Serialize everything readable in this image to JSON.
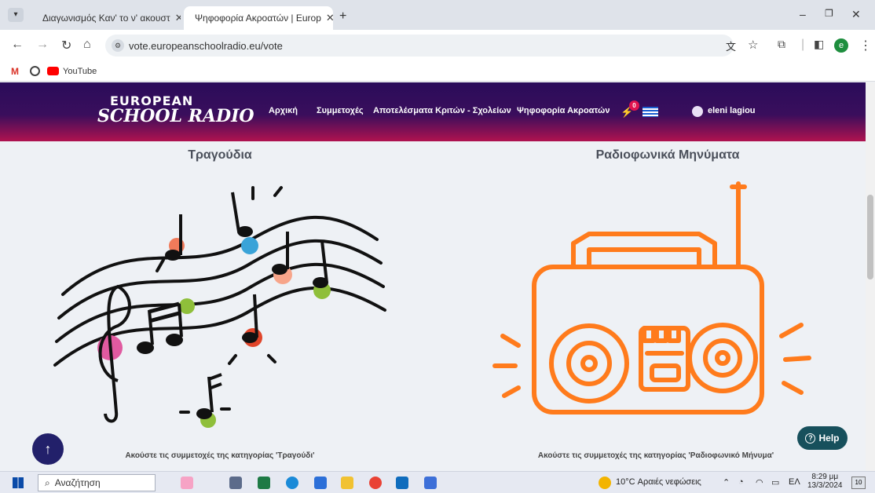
{
  "browser": {
    "tabs": [
      {
        "title": "Διαγωνισμός Καν' το ν' ακουστ"
      },
      {
        "title": "Ψηφοφορία Ακροατών | Europ"
      }
    ],
    "url": "vote.europeanschoolradio.eu/vote",
    "bookmarks": [
      {
        "label": "YouTube"
      }
    ],
    "profile_initial": "e"
  },
  "site": {
    "logo_top": "EUROPEAN",
    "logo_bottom": "SCHOOL RADIO",
    "nav": {
      "home": "Αρχική",
      "entries": "Συμμετοχές",
      "results": "Αποτελέσματα Κριτών - Σχολείων",
      "vote": "Ψηφοφορία Ακροατών",
      "badge_count": "0"
    },
    "user_name": "eleni lagiou"
  },
  "sections": [
    {
      "title": "Τραγούδια",
      "caption": "Ακούστε τις συμμετοχές της κατηγορίας 'Τραγούδι'"
    },
    {
      "title": "Ραδιοφωνικά Μηνύματα",
      "caption": "Ακούστε τις συμμετοχές της κατηγορίας 'Ραδιοφωνικό Μήνυμα'"
    }
  ],
  "help_label": "Help",
  "up_icon": "↑",
  "taskbar": {
    "search_placeholder": "Αναζήτηση",
    "weather": "10°C  Αραιές νεφώσεις",
    "language": "ΕΛ",
    "time": "8:29 μμ",
    "date": "13/3/2024",
    "notifications": "10"
  },
  "colors": {
    "header_top": "#2a0c5a",
    "header_bottom": "#b0124f",
    "radio_orange": "#ff7b1c",
    "help_bg": "#17505c",
    "up_button_bg": "#22206a"
  }
}
